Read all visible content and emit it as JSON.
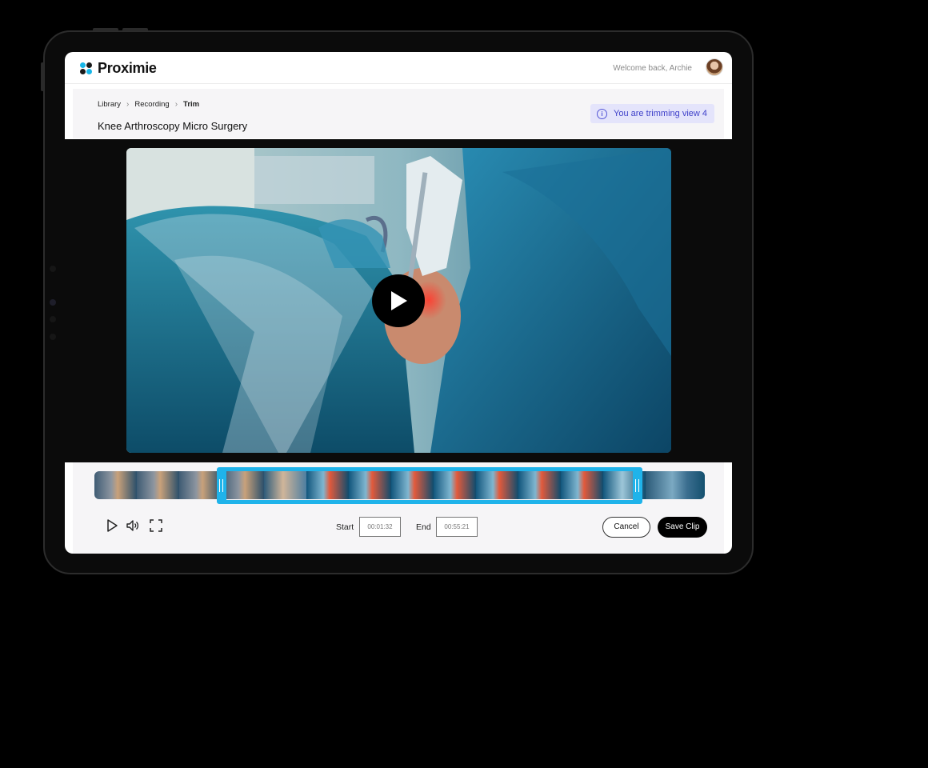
{
  "header": {
    "brand": "Proximie",
    "welcome": "Welcome back, Archie"
  },
  "breadcrumb": [
    {
      "label": "Library"
    },
    {
      "label": "Recording"
    },
    {
      "label": "Trim"
    }
  ],
  "page_title": "Knee Arthroscopy Micro Surgery",
  "notice": {
    "icon": "info-icon",
    "text": "You are trimming view 4"
  },
  "video": {
    "play_icon": "play-icon"
  },
  "trim": {
    "start_label": "Start",
    "start_value": "00:01:32",
    "end_label": "End",
    "end_value": "00:55:21"
  },
  "actions": {
    "cancel": "Cancel",
    "save": "Save Clip"
  },
  "colors": {
    "accent": "#1fb3ea",
    "notice_bg": "#e4e4fb",
    "notice_text": "#3d3fc9",
    "brand_dots": [
      "#16b6e8",
      "#1a1a1a",
      "#1a1a1a",
      "#16b6e8"
    ]
  }
}
